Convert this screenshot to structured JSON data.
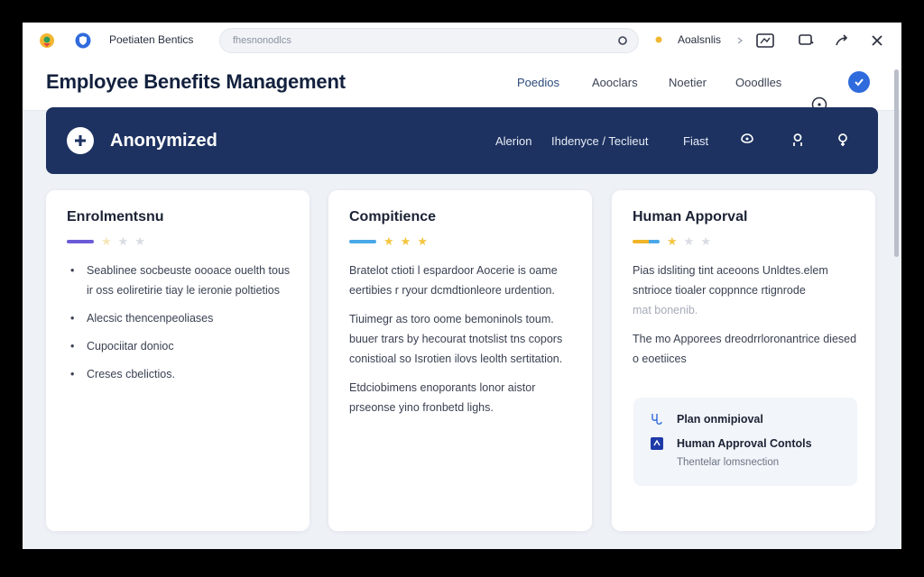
{
  "browser": {
    "tab_title": "Poetiaten Bentics",
    "url": "fhesnonodlcs",
    "profile_label": "Aoalsnlis"
  },
  "app": {
    "title": "Employee Benefits Management",
    "nav": [
      "Poedios",
      "Aooclars",
      "Noetier",
      "Ooodlles"
    ]
  },
  "banner": {
    "title": "Anonymized",
    "links": [
      "Alerion",
      "Ihdenyce / Teclieut",
      "Fiast"
    ]
  },
  "cards": [
    {
      "title": "Enrolmentsnu",
      "rating": {
        "bar_color": "#6b5bd6",
        "filled": 0,
        "total": 3
      },
      "bullets": [
        "Seablinee socbeuste oooace ouelth tous ir oss eoliretirie tiay le ieronie poltietios",
        "Alecsic thencenpeoliases",
        "Cupociitar donioc",
        "Creses cbelictios."
      ]
    },
    {
      "title": "Compitience",
      "rating": {
        "bar_color": "#4aa8e8",
        "filled": 3,
        "total": 3
      },
      "paragraphs": [
        "Bratelot ctioti l espardoor Aocerie is oame eertibies r ryour dcmdtionleore urdention.",
        "Tiuimegr as toro oome bemoninols toum. buuer trars by hecourat tnotslist tns copors conistioal so Isrotien ilovs leolth sertitation.",
        "Etdciobimens enoporants lonor aistor prseonse yino fronbetd lighs."
      ]
    },
    {
      "title": "Human Apporval",
      "rating": {
        "bar_color": "#f0b429",
        "filled": 1,
        "total": 3
      },
      "paragraphs": [
        "Pias idsliting tint aceoons Unldtes.elem sntrioce tioaler coppnnce rtignrode",
        "The mo Apporees dreodrrloronantrice diesed o eoetiices"
      ],
      "muted_line": "mat bonenib.",
      "approval": {
        "items": [
          "Plan onmipioval",
          "Human Approval Contols"
        ],
        "subtext": "Thentelar lomsnection"
      }
    }
  ],
  "colors": {
    "banner_bg": "#1d3260",
    "accent_blue": "#2f6bdc",
    "star_gold": "#f4c542",
    "star_gray": "#d9dce3"
  }
}
